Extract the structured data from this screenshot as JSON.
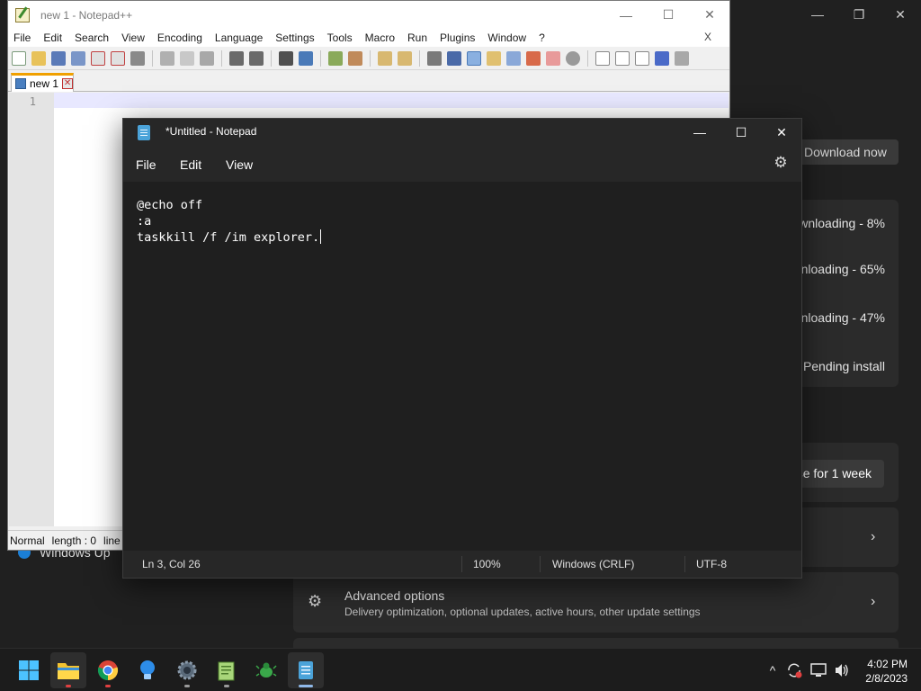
{
  "settings": {
    "download_button": "Download now",
    "updates": [
      {
        "status": "wnloading - 8%"
      },
      {
        "status": "nloading - 65%"
      },
      {
        "status": "nloading - 47%"
      },
      {
        "status": "Pending install"
      }
    ],
    "pause_button": "se for 1 week",
    "windows_update_label": "Windows Up",
    "advanced_options": {
      "title": "Advanced options",
      "subtitle": "Delivery optimization, optional updates, active hours, other update settings"
    },
    "caption": {
      "minimize": "—",
      "maximize": "❐",
      "close": "✕"
    }
  },
  "notepadpp": {
    "title": "new 1 - Notepad++",
    "menu": [
      "File",
      "Edit",
      "Search",
      "View",
      "Encoding",
      "Language",
      "Settings",
      "Tools",
      "Macro",
      "Run",
      "Plugins",
      "Window",
      "?"
    ],
    "menu_close": "X",
    "tab_label": "new 1",
    "tab_close": "✕",
    "line_number": "1",
    "status": {
      "mode": "Normal",
      "length": "length : 0",
      "line": "line"
    },
    "caption": {
      "minimize": "—",
      "maximize": "☐",
      "close": "✕"
    }
  },
  "notepad": {
    "title": "*Untitled - Notepad",
    "menu": {
      "file": "File",
      "edit": "Edit",
      "view": "View"
    },
    "content_lines": [
      "@echo off",
      ":a",
      "taskkill /f /im explorer."
    ],
    "status": {
      "position": "Ln 3, Col 26",
      "zoom": "100%",
      "line_ending": "Windows (CRLF)",
      "encoding": "UTF-8"
    },
    "caption": {
      "minimize": "—",
      "maximize": "☐",
      "close": "✕"
    },
    "gear_glyph": "⚙"
  },
  "taskbar": {
    "apps": [
      "windows-start",
      "file-explorer",
      "chrome",
      "tips",
      "settings",
      "notepadpp",
      "git-bash",
      "notepad"
    ],
    "tray": {
      "chevron": "^"
    },
    "clock": {
      "time": "4:02 PM",
      "date": "2/8/2023"
    }
  },
  "colors": {
    "accent": "#4ba3d9",
    "notepadpp_tab_accent": "#f0a000",
    "dark_bg": "#1f1f1f"
  }
}
